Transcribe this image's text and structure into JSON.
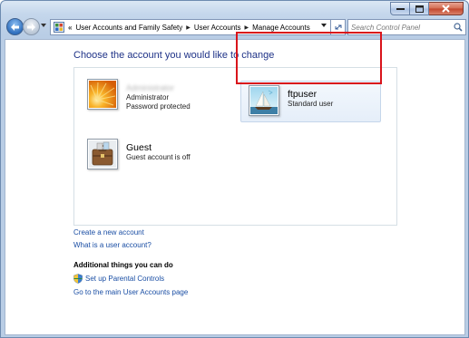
{
  "window": {
    "caption": {
      "minimize": "minimize",
      "maximize": "maximize",
      "close": "close"
    }
  },
  "address_bar": {
    "overflow_chevron": "«",
    "crumbs": [
      "User Accounts and Family Safety",
      "User Accounts",
      "Manage Accounts"
    ]
  },
  "search": {
    "placeholder": "Search Control Panel"
  },
  "main": {
    "title": "Choose the account you would like to change",
    "accounts": [
      {
        "name": "Administrator",
        "type": "Administrator",
        "status": "Password protected",
        "picture": "orange-flower-icon"
      },
      {
        "name": "ftpuser",
        "type": "Standard user",
        "picture": "sailboat-icon"
      },
      {
        "name": "Guest",
        "type": "Guest account is off",
        "picture": "suitcase-icon"
      }
    ],
    "links": {
      "create_account": "Create a new account",
      "what_is": "What is a user account?"
    },
    "additional": {
      "heading": "Additional things you can do",
      "parental": "Set up Parental Controls",
      "main_page": "Go to the main User Accounts page"
    }
  },
  "colors": {
    "title": "#1e3287",
    "link": "#1a4ea4",
    "highlight_border": "#d9141b"
  }
}
